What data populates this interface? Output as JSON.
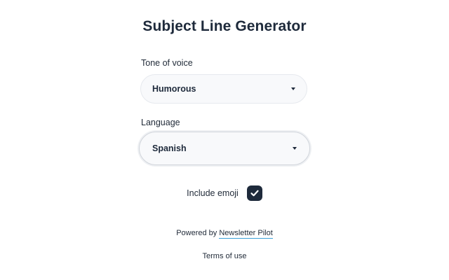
{
  "header": {
    "title": "Subject Line Generator"
  },
  "form": {
    "tone": {
      "label": "Tone of voice",
      "value": "Humorous"
    },
    "language": {
      "label": "Language",
      "value": "Spanish"
    },
    "emoji": {
      "label": "Include emoji",
      "checked": true
    }
  },
  "footer": {
    "powered_prefix": "Powered by",
    "powered_link": "Newsletter Pilot",
    "powered_link_color": "#3aa0d8",
    "terms": "Terms of use"
  },
  "colors": {
    "primary": "#1e2a3b",
    "select_bg": "#f8f9fb"
  },
  "icons": {
    "dropdown": "chevron-down-icon",
    "checkmark": "checkmark-icon"
  }
}
